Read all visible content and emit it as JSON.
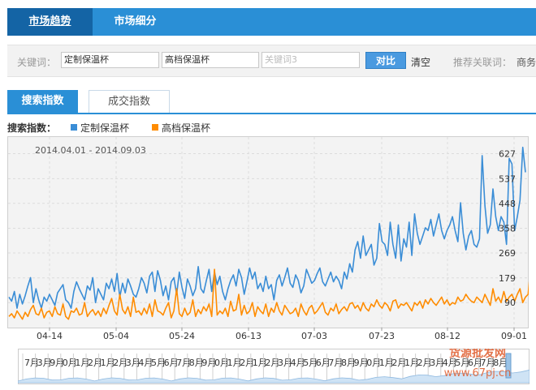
{
  "nav": {
    "tabs": [
      {
        "label": "市场趋势",
        "active": true
      },
      {
        "label": "市场细分",
        "active": false
      }
    ]
  },
  "keywords": {
    "label": "关键词：",
    "inputs": [
      {
        "value": "定制保温杯",
        "placeholder": ""
      },
      {
        "value": "高档保温杯",
        "placeholder": ""
      },
      {
        "value": "",
        "placeholder": "关键词3"
      }
    ],
    "compare_label": "对比",
    "clear_label": "清空",
    "recommend_label": "推荐关联词：",
    "recommend_value": "商务"
  },
  "subtabs": [
    {
      "label": "搜索指数",
      "active": true
    },
    {
      "label": "成交指数",
      "active": false
    }
  ],
  "legend": {
    "title": "搜索指数：",
    "items": [
      {
        "name": "定制保温杯",
        "color": "#3a8dd6"
      },
      {
        "name": "高档保温杯",
        "color": "#ff8c00"
      }
    ]
  },
  "navigator_labels": [
    "7月",
    "3月",
    "9月",
    "0月",
    "1月",
    "2月",
    "1月",
    "2月",
    "3月",
    "4月",
    "5月",
    "6月",
    "7月",
    "8月",
    "9月",
    "0月",
    "1月",
    "2月",
    "1月",
    "2月",
    "3月",
    "4月",
    "5月",
    "6月",
    "7月",
    "8月",
    "9月",
    "0月",
    "1月",
    "2月",
    "1月",
    "2月",
    "3月",
    "4月",
    "5月",
    "6月",
    "7月",
    "8月",
    "9月"
  ],
  "watermark": {
    "line1": "货源批发网",
    "line2": "www.67pj.cn"
  },
  "chart_data": {
    "type": "line",
    "date_range": "2014.04.01 - 2014.09.03",
    "x_ticks": [
      "04-14",
      "05-04",
      "05-24",
      "06-13",
      "07-03",
      "07-23",
      "08-12",
      "09-01"
    ],
    "y_ticks": [
      90,
      179,
      269,
      358,
      448,
      537,
      627
    ],
    "ylim": [
      0,
      690
    ],
    "grid": true,
    "series": [
      {
        "name": "定制保温杯",
        "color": "#3a8dd6",
        "values": [
          110,
          95,
          130,
          70,
          120,
          85,
          115,
          150,
          180,
          90,
          140,
          100,
          70,
          110,
          95,
          120,
          100,
          80,
          125,
          140,
          155,
          100,
          90,
          70,
          130,
          165,
          140,
          120,
          100,
          150,
          135,
          180,
          90,
          140,
          120,
          100,
          160,
          140,
          175,
          130,
          195,
          110,
          160,
          125,
          175,
          150,
          120,
          110,
          140,
          180,
          160,
          125,
          185,
          200,
          130,
          205,
          170,
          115,
          150,
          100,
          165,
          180,
          120,
          200,
          145,
          105,
          175,
          150,
          115,
          140,
          220,
          140,
          125,
          170,
          210,
          130,
          200,
          155,
          185,
          130,
          100,
          140,
          170,
          190,
          150,
          210,
          180,
          120,
          165,
          215,
          175,
          200,
          140,
          160,
          130,
          185,
          140,
          155,
          100,
          170,
          190,
          150,
          180,
          215,
          160,
          145,
          190,
          170,
          125,
          150,
          210,
          185,
          160,
          170,
          195,
          215,
          165,
          150,
          175,
          200,
          165,
          185,
          170,
          140,
          200,
          175,
          230,
          200,
          280,
          310,
          250,
          330,
          260,
          280,
          300,
          225,
          250,
          375,
          310,
          300,
          260,
          380,
          300,
          250,
          370,
          240,
          320,
          290,
          380,
          260,
          410,
          340,
          300,
          330,
          360,
          350,
          390,
          330,
          370,
          410,
          350,
          320,
          350,
          370,
          400,
          350,
          310,
          450,
          340,
          280,
          330,
          350,
          300,
          290,
          320,
          620,
          440,
          340,
          370,
          500,
          400,
          350,
          400,
          380,
          300,
          610,
          590,
          350,
          400,
          460,
          650,
          560
        ]
      },
      {
        "name": "高档保温杯",
        "color": "#ff8c00",
        "values": [
          40,
          50,
          35,
          60,
          45,
          30,
          55,
          40,
          65,
          80,
          50,
          45,
          70,
          35,
          55,
          60,
          40,
          75,
          50,
          45,
          85,
          40,
          30,
          60,
          55,
          70,
          45,
          50,
          90,
          40,
          55,
          65,
          45,
          60,
          40,
          70,
          50,
          80,
          105,
          60,
          45,
          120,
          65,
          50,
          75,
          40,
          110,
          55,
          60,
          45,
          70,
          50,
          85,
          40,
          100,
          60,
          55,
          45,
          70,
          90,
          35,
          60,
          140,
          50,
          40,
          70,
          45,
          55,
          100,
          40,
          65,
          50,
          75,
          60,
          85,
          40,
          210,
          45,
          60,
          50,
          70,
          40,
          95,
          60,
          65,
          120,
          45,
          80,
          50,
          60,
          90,
          40,
          75,
          60,
          50,
          85,
          40,
          70,
          55,
          90,
          60,
          45,
          80,
          65,
          50,
          55,
          70,
          40,
          85,
          60,
          45,
          70,
          80,
          50,
          60,
          75,
          90,
          55,
          45,
          70,
          60,
          85,
          50,
          65,
          75,
          60,
          85,
          90,
          70,
          80,
          60,
          90,
          70,
          60,
          85,
          75,
          100,
          80,
          70,
          90,
          80,
          60,
          95,
          100,
          70,
          85,
          80,
          90,
          75,
          60,
          90,
          80,
          95,
          70,
          100,
          85,
          105,
          90,
          80,
          95,
          110,
          85,
          100,
          80,
          90,
          85,
          110,
          95,
          100,
          120,
          105,
          95,
          90,
          110,
          100,
          90,
          120,
          100,
          80,
          140,
          95,
          110,
          90,
          130,
          95,
          110,
          120,
          95,
          120,
          140,
          90,
          110,
          120,
          230,
          150,
          190,
          120,
          130
        ]
      }
    ]
  }
}
